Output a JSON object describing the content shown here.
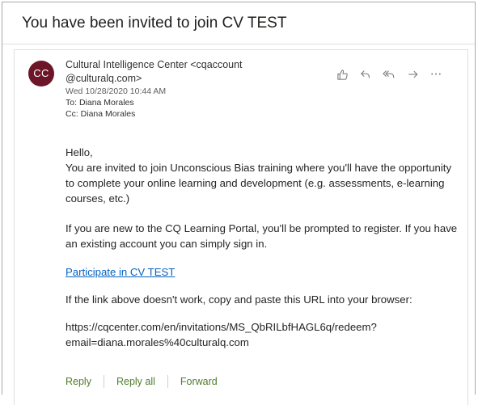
{
  "email": {
    "subject": "You have been invited to join CV TEST",
    "avatar_initials": "CC",
    "avatar_color": "#6c1628",
    "sender_line1": "Cultural Intelligence Center <cqaccount",
    "sender_line2": "@culturalq.com>",
    "date": "Wed 10/28/2020 10:44 AM",
    "to_label": "To:",
    "to_value": "Diana Morales",
    "cc_label": "Cc:",
    "cc_value": "Diana Morales"
  },
  "actions": {
    "like_icon": "thumbs-up-icon",
    "reply_icon": "reply-icon",
    "reply_all_icon": "reply-all-icon",
    "forward_icon": "forward-arrow-icon",
    "more_label": "···"
  },
  "body": {
    "greeting": "Hello,",
    "invite_text": "You are invited to join Unconscious Bias training where you'll have the opportunity to complete your online learning and development (e.g. assessments, e-learning courses, etc.)",
    "new_user_text": "If you are new to the CQ Learning Portal, you'll be prompted to register. If you have an existing account you can simply sign in.",
    "link_text": "Participate in CV TEST",
    "copy_text": "If the link above doesn't work, copy and paste this URL into your browser:",
    "url_line1": "https://cqcenter.com/en/invitations/MS_QbRILbfHAGL6q/redeem?",
    "url_line2": "email=diana.morales%40culturalq.com",
    "link_color": "#0563c1"
  },
  "footer": {
    "reply_label": "Reply",
    "reply_all_label": "Reply all",
    "forward_label": "Forward",
    "accent_color": "#4f7b2c"
  }
}
